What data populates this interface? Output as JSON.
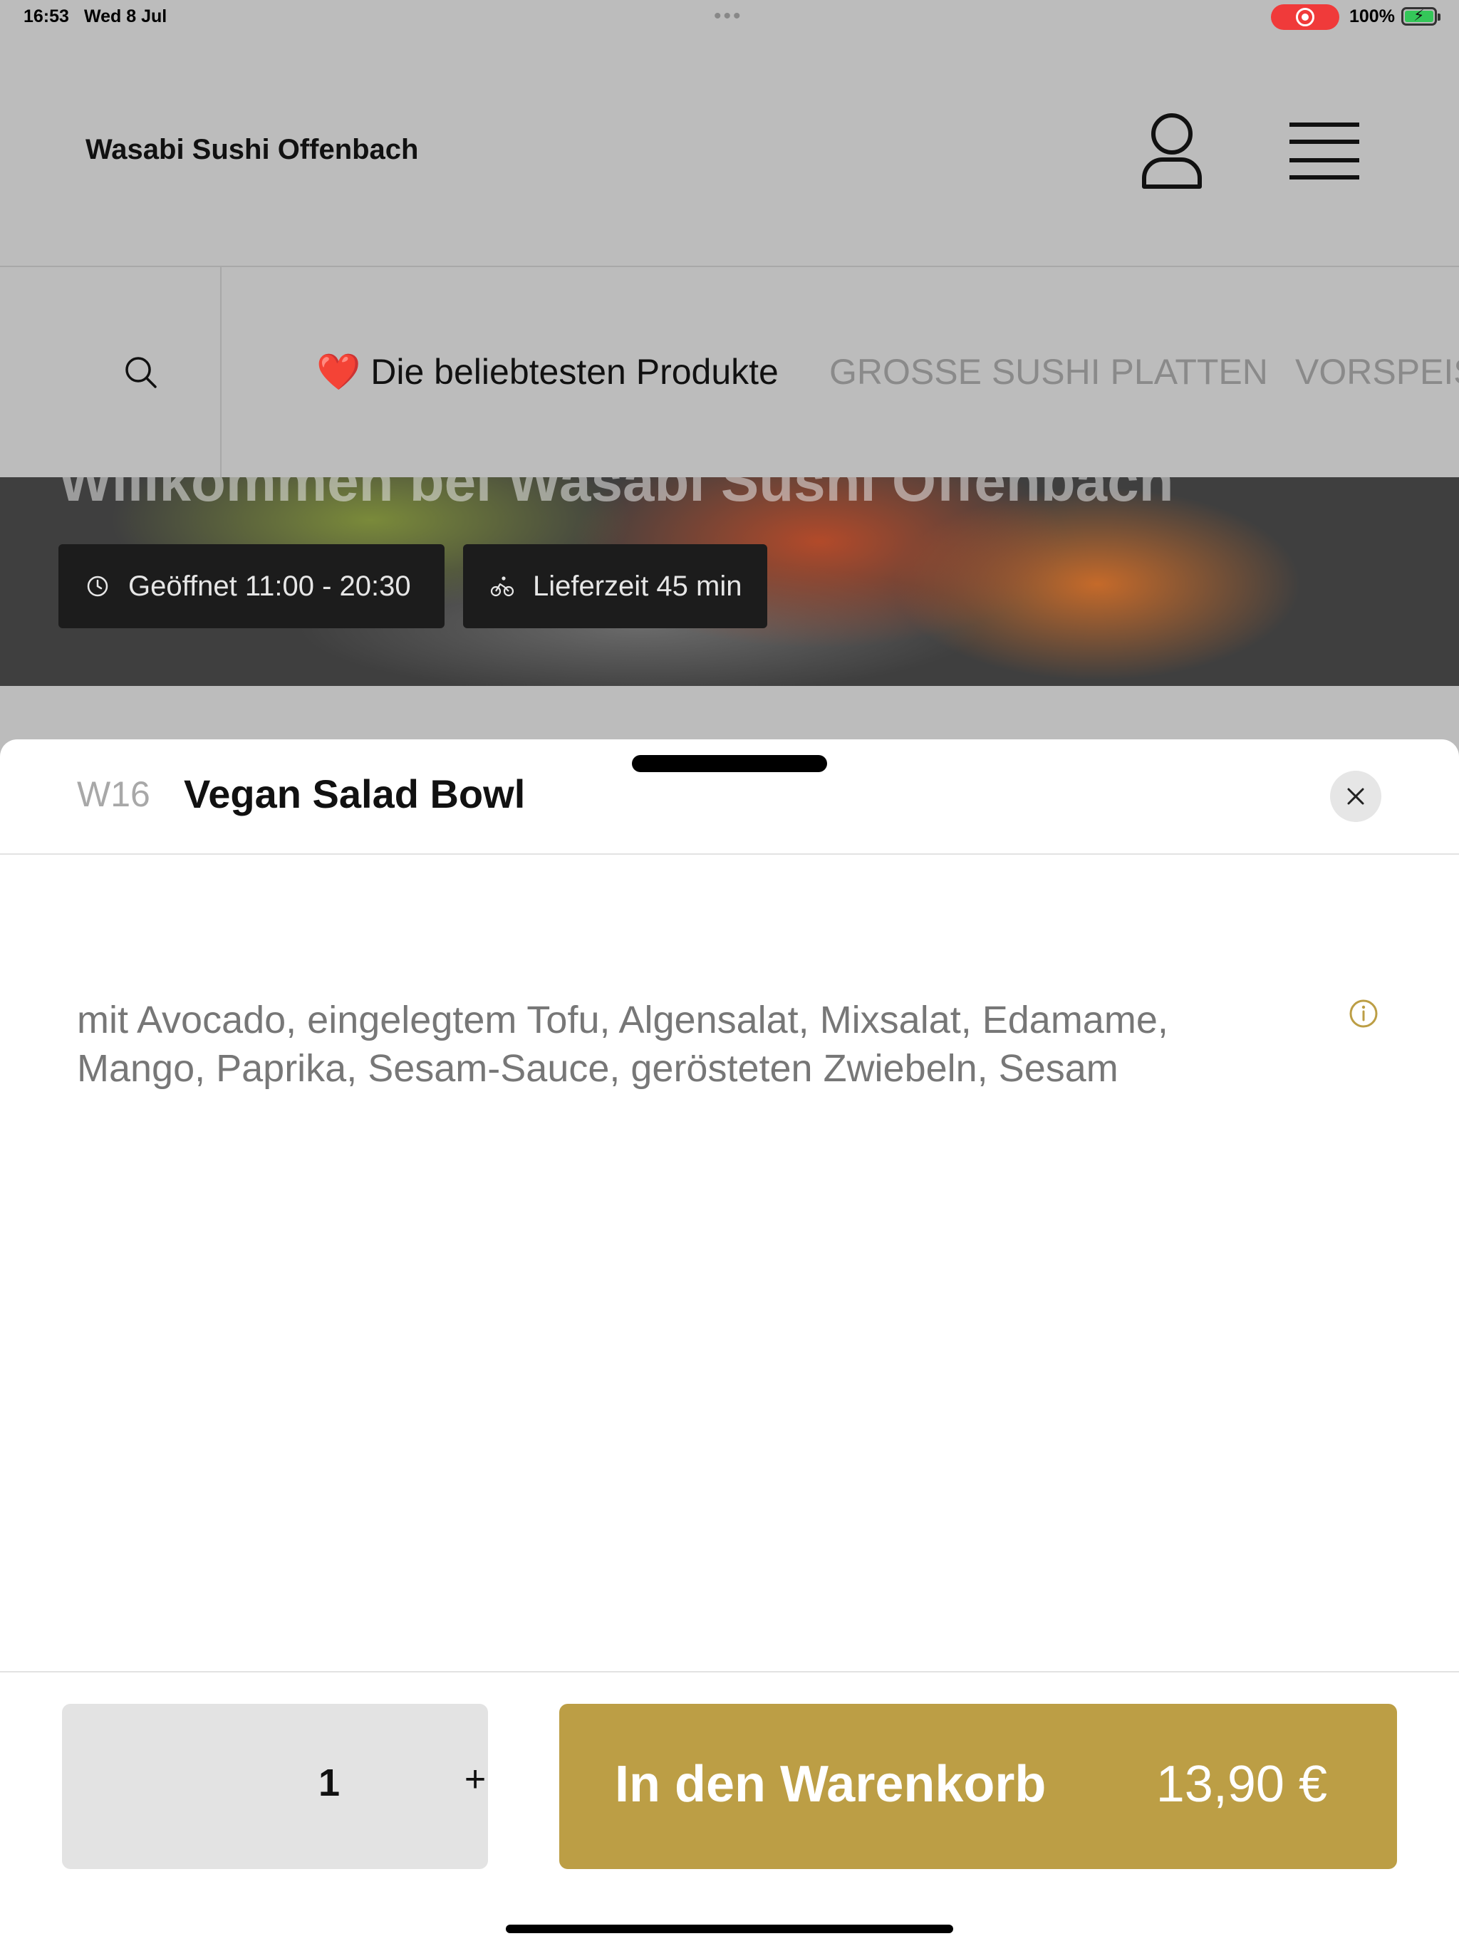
{
  "status_bar": {
    "time": "16:53",
    "date": "Wed 8 Jul",
    "multitask_dots": "•••",
    "battery_percent": "100%",
    "battery_level": 1.0,
    "recording_color": "#f03a3a"
  },
  "header": {
    "restaurant_name": "Wasabi Sushi Offenbach",
    "user_icon": "user-icon",
    "menu_icon": "hamburger-menu-icon"
  },
  "categories": {
    "search_icon": "search-icon",
    "items": [
      {
        "icon": "heart",
        "label": "Die beliebtesten Produkte",
        "active": true
      },
      {
        "label": "GROSSE SUSHI PLATTEN",
        "active": false
      },
      {
        "label": "VORSPEIS",
        "active": false
      }
    ],
    "heart_glyph": "❤️"
  },
  "hero": {
    "title": "Willkommen bei Wasabi Sushi Offenbach",
    "opening_hours": "Geöffnet 11:00 - 20:30",
    "delivery_time": "Lieferzeit 45 min"
  },
  "product": {
    "code": "W16",
    "name": "Vegan Salad Bowl",
    "description": "mit Avocado, eingelegtem Tofu, Algensalat, Mixsalat, Edamame, Mango, Paprika, Sesam-Sauce, gerösteten Zwiebeln, Sesam"
  },
  "order": {
    "quantity": "1",
    "plus_label": "+",
    "add_to_cart_label": "In den Warenkorb",
    "price": "13,90 €"
  },
  "colors": {
    "accent": "#bc9e45",
    "overlay": "#bcbcbc",
    "sheet_background": "#ffffff"
  }
}
